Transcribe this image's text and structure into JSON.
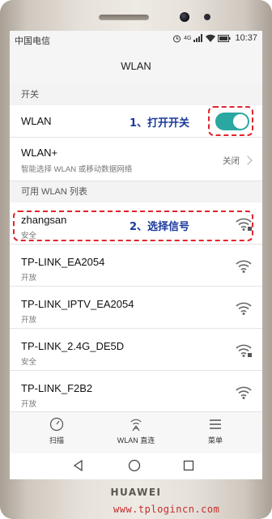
{
  "status_bar": {
    "carrier": "中国电信",
    "network": "4G",
    "time": "10:37"
  },
  "app_bar": {
    "title": "WLAN"
  },
  "sections": {
    "switch": "开关",
    "available": "可用 WLAN 列表"
  },
  "wlan_toggle": {
    "label": "WLAN",
    "on": true,
    "accent_color": "#2aa7a0"
  },
  "wlan_plus": {
    "label": "WLAN+",
    "subtitle": "智能选择 WLAN 或移动数据网络",
    "value": "关闭"
  },
  "networks": [
    {
      "ssid": "zhangsan",
      "security": "安全",
      "locked": true
    },
    {
      "ssid": "TP-LINK_EA2054",
      "security": "开放",
      "locked": false
    },
    {
      "ssid": "TP-LINK_IPTV_EA2054",
      "security": "开放",
      "locked": false
    },
    {
      "ssid": "TP-LINK_2.4G_DE5D",
      "security": "安全",
      "locked": true
    },
    {
      "ssid": "TP-LINK_F2B2",
      "security": "开放",
      "locked": false
    }
  ],
  "annotations": {
    "step1": "1、打开开关",
    "step2": "2、选择信号",
    "color": "#1a3a9c",
    "box_color": "#e0252c"
  },
  "bottom_bar": {
    "scan": "扫描",
    "direct": "WLAN 直连",
    "menu": "菜单"
  },
  "device": {
    "brand": "HUAWEI",
    "watermark": "www.tplogincn.com"
  }
}
